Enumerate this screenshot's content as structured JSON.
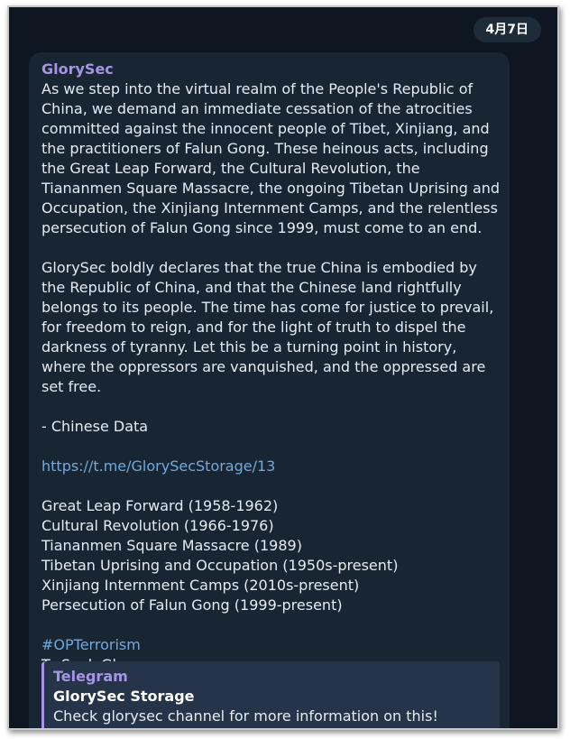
{
  "date": "4月7日",
  "message": {
    "sender": "GlorySec",
    "paragraph1": "As we step into the virtual realm of the People's Republic of China, we demand an immediate cessation of the atrocities committed against the innocent people of Tibet, Xinjiang, and the practitioners of Falun Gong. These heinous acts, including the Great Leap Forward, the Cultural Revolution, the Tiananmen Square Massacre, the ongoing Tibetan Uprising and Occupation, the Xinjiang Internment Camps, and the relentless persecution of Falun Gong since 1999, must come to an end.",
    "paragraph2": "GlorySec boldly declares that the true China is embodied by the Republic of China, and that the Chinese land rightfully belongs to its people. The time has come for justice to prevail, for freedom to reign, and for the light of truth to dispel the darkness of tyranny. Let this be a turning point in history, where the oppressors are vanquished, and the oppressed are set free.",
    "source_note": "- Chinese Data",
    "link": "https://t.me/GlorySecStorage/13",
    "list": [
      "Great Leap Forward (1958-1962)",
      "Cultural Revolution (1966-1976)",
      "Tiananmen Square Massacre (1989)",
      "Tibetan Uprising and Occupation (1950s-present)",
      "Xinjiang Internment Camps (2010s-present)",
      "Persecution of Falun Gong (1999-present)"
    ],
    "hashtag": "#OPTerrorism",
    "closing": "To Seek Glory"
  },
  "preview": {
    "site": "Telegram",
    "title": "GlorySec Storage",
    "description": "Check glorysec channel for more information on this!"
  }
}
